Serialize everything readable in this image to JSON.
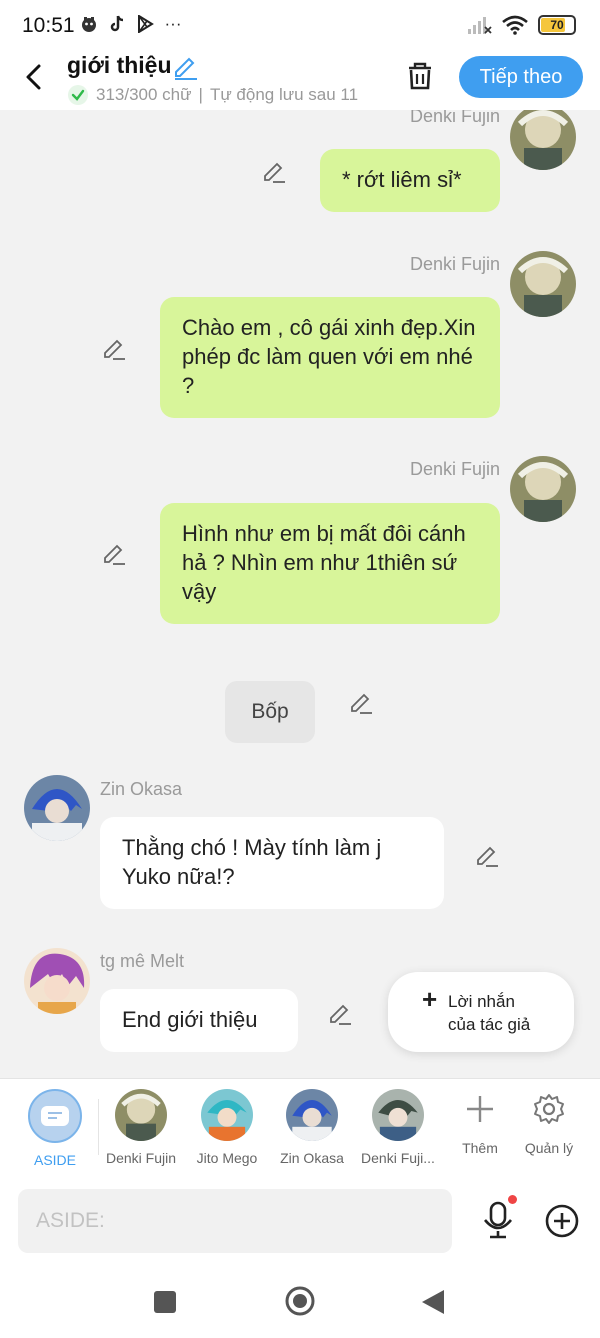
{
  "status_bar": {
    "time": "10:51",
    "battery": "70",
    "more": "···"
  },
  "header": {
    "title": "giới thiệu",
    "word_count": "313/300 chữ",
    "autosave": "Tự động lưu sau 11",
    "next_label": "Tiếp theo"
  },
  "messages": [
    {
      "speaker": "Denki Fujin",
      "text": "* rớt liêm sỉ*"
    },
    {
      "speaker": "Denki Fujin",
      "text": "Chào em , cô gái xinh đẹp.Xin phép đc làm quen với em nhé ?"
    },
    {
      "speaker": "Denki Fujin",
      "text": "Hình như em bị mất đôi cánh hả ? Nhìn em như 1thiên sứ vậy"
    },
    {
      "speaker": "",
      "text": "Bốp"
    },
    {
      "speaker": "Zin Okasa",
      "text": "Thằng chó ! Mày tính làm j Yuko nữa!?"
    },
    {
      "speaker": "tg mê Melt",
      "text": "End giới thiệu"
    }
  ],
  "author_note": {
    "line1": "Lời nhắn",
    "line2": "của tác giả"
  },
  "characters": [
    {
      "label": "ASIDE",
      "active": true
    },
    {
      "label": "Denki Fujin"
    },
    {
      "label": "Jito Mego"
    },
    {
      "label": "Zin Okasa"
    },
    {
      "label": "Denki Fuji..."
    }
  ],
  "tools": {
    "add_label": "Thêm",
    "manage_label": "Quản lý"
  },
  "input": {
    "placeholder": "ASIDE:"
  },
  "colors": {
    "accent": "#3f9ef0",
    "bubble_green": "#d8f59a",
    "background": "#f2f2f2"
  }
}
